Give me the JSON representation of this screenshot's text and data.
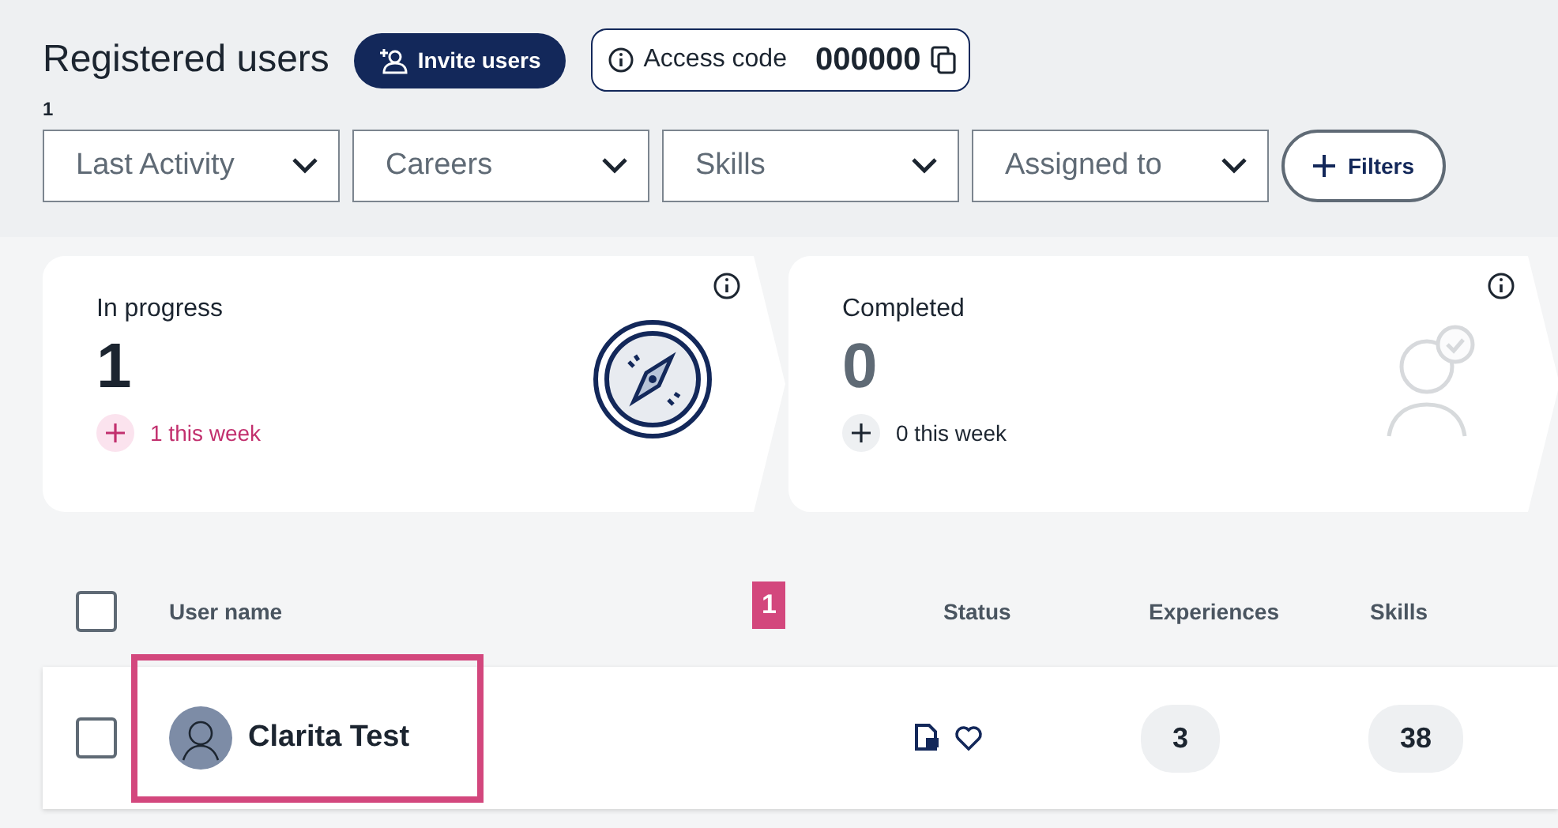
{
  "header": {
    "title": "Registered users",
    "invite_button": "Invite users",
    "access_code": {
      "label": "Access code",
      "code": "000000"
    },
    "count": "1"
  },
  "filters": [
    {
      "label": "Last Activity"
    },
    {
      "label": "Careers"
    },
    {
      "label": "Skills"
    },
    {
      "label": "Assigned to"
    }
  ],
  "filters_button": "Filters",
  "stat_cards": [
    {
      "title": "In progress",
      "value": "1",
      "change": "1 this week",
      "kind": "active"
    },
    {
      "title": "Completed",
      "value": "0",
      "change": "0 this week",
      "kind": "done"
    }
  ],
  "table": {
    "select_all": {
      "checked": false
    },
    "columns": [
      "User name",
      "Status",
      "Experiences",
      "Skills"
    ],
    "rows": [
      {
        "name": "Clarita Test",
        "selected": false,
        "experiences": "3",
        "skills": "38"
      }
    ]
  },
  "annotation": {
    "label": "1"
  }
}
